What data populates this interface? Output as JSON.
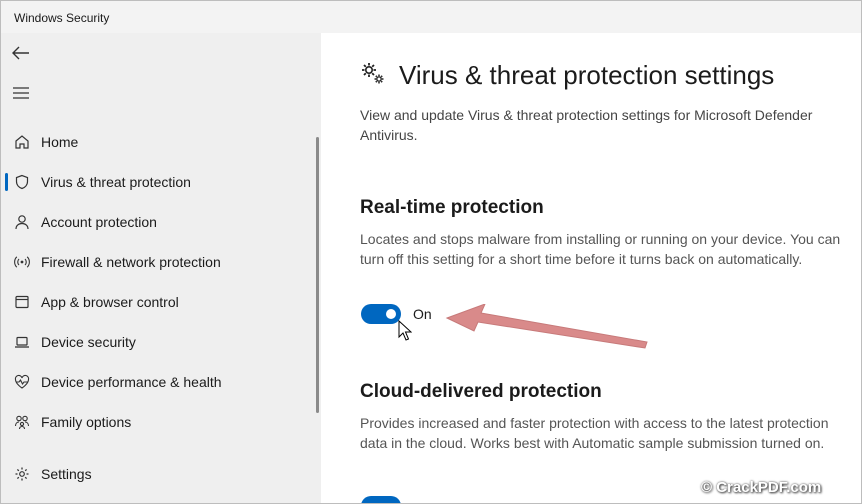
{
  "window": {
    "title": "Windows Security"
  },
  "sidebar": {
    "items": [
      {
        "label": "Home",
        "icon": "home-icon"
      },
      {
        "label": "Virus & threat protection",
        "icon": "shield-icon",
        "active": true
      },
      {
        "label": "Account protection",
        "icon": "person-icon"
      },
      {
        "label": "Firewall & network protection",
        "icon": "wireless-icon"
      },
      {
        "label": "App & browser control",
        "icon": "app-window-icon"
      },
      {
        "label": "Device security",
        "icon": "laptop-icon"
      },
      {
        "label": "Device performance & health",
        "icon": "heartbeat-icon"
      },
      {
        "label": "Family options",
        "icon": "family-icon"
      }
    ],
    "settings": {
      "label": "Settings",
      "icon": "gear-icon"
    }
  },
  "main": {
    "title": "Virus & threat protection settings",
    "description": "View and update Virus & threat protection settings for Microsoft Defender Antivirus.",
    "sections": [
      {
        "title": "Real-time protection",
        "description": "Locates and stops malware from installing or running on your device. You can turn off this setting for a short time before it turns back on automatically.",
        "toggle_state": "On"
      },
      {
        "title": "Cloud-delivered protection",
        "description": "Provides increased and faster protection with access to the latest protection data in the cloud. Works best with Automatic sample submission turned on."
      }
    ]
  },
  "watermark": "© CrackPDF.com",
  "colors": {
    "accent": "#0067c0",
    "arrow": "#d98a8a",
    "sidebar_bg": "#efefef"
  }
}
